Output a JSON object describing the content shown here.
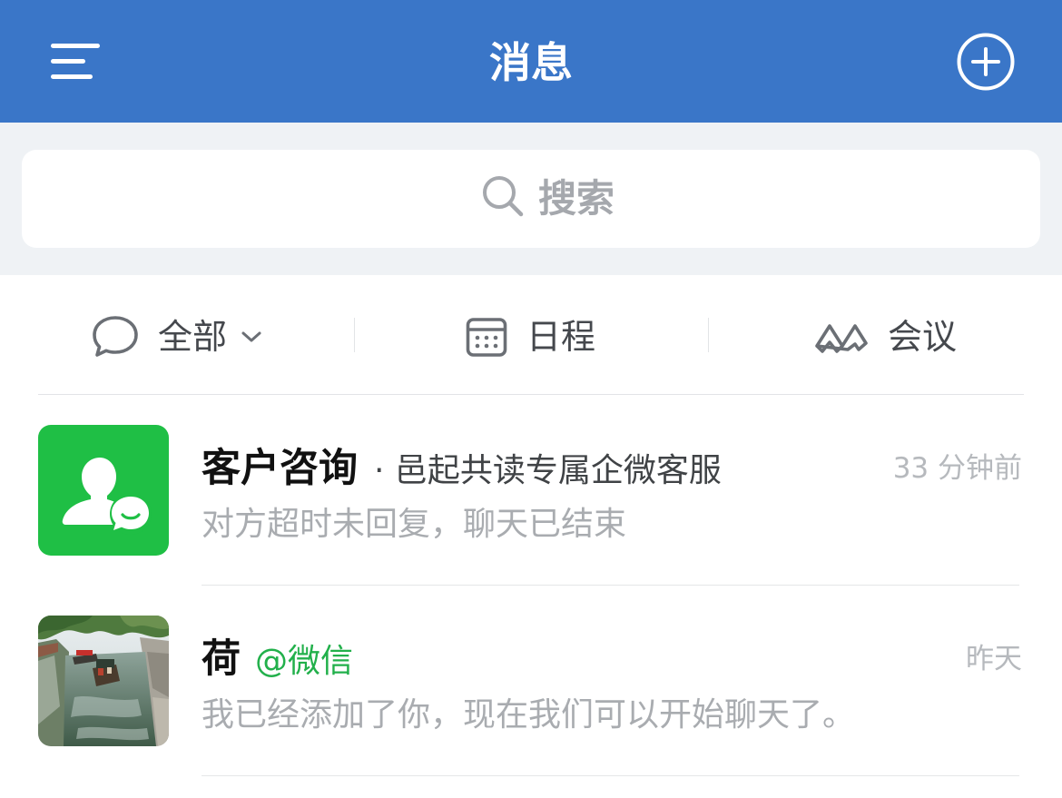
{
  "header": {
    "title": "消息",
    "menu_icon": "menu-icon",
    "add_icon": "plus-circle-icon",
    "bg_color": "#3a76c8"
  },
  "search": {
    "placeholder": "搜索",
    "icon": "search-icon"
  },
  "filters": [
    {
      "label": "全部",
      "icon": "chat-bubble-icon",
      "has_dropdown": true
    },
    {
      "label": "日程",
      "icon": "calendar-icon"
    },
    {
      "label": "会议",
      "icon": "meeting-icon"
    }
  ],
  "conversations": [
    {
      "name": "客户咨询",
      "subtitle": "· 邑起共读专属企微客服",
      "time": "33 分钟前",
      "preview": "对方超时未回复，聊天已结束",
      "avatar": "customer-service-icon",
      "avatar_color": "#1fbf45"
    },
    {
      "name": "荷",
      "tag": "@微信",
      "tag_color": "#22b04b",
      "time": "昨天",
      "preview": "我已经添加了你，现在我们可以开始聊天了。",
      "avatar": "river-photo"
    }
  ]
}
